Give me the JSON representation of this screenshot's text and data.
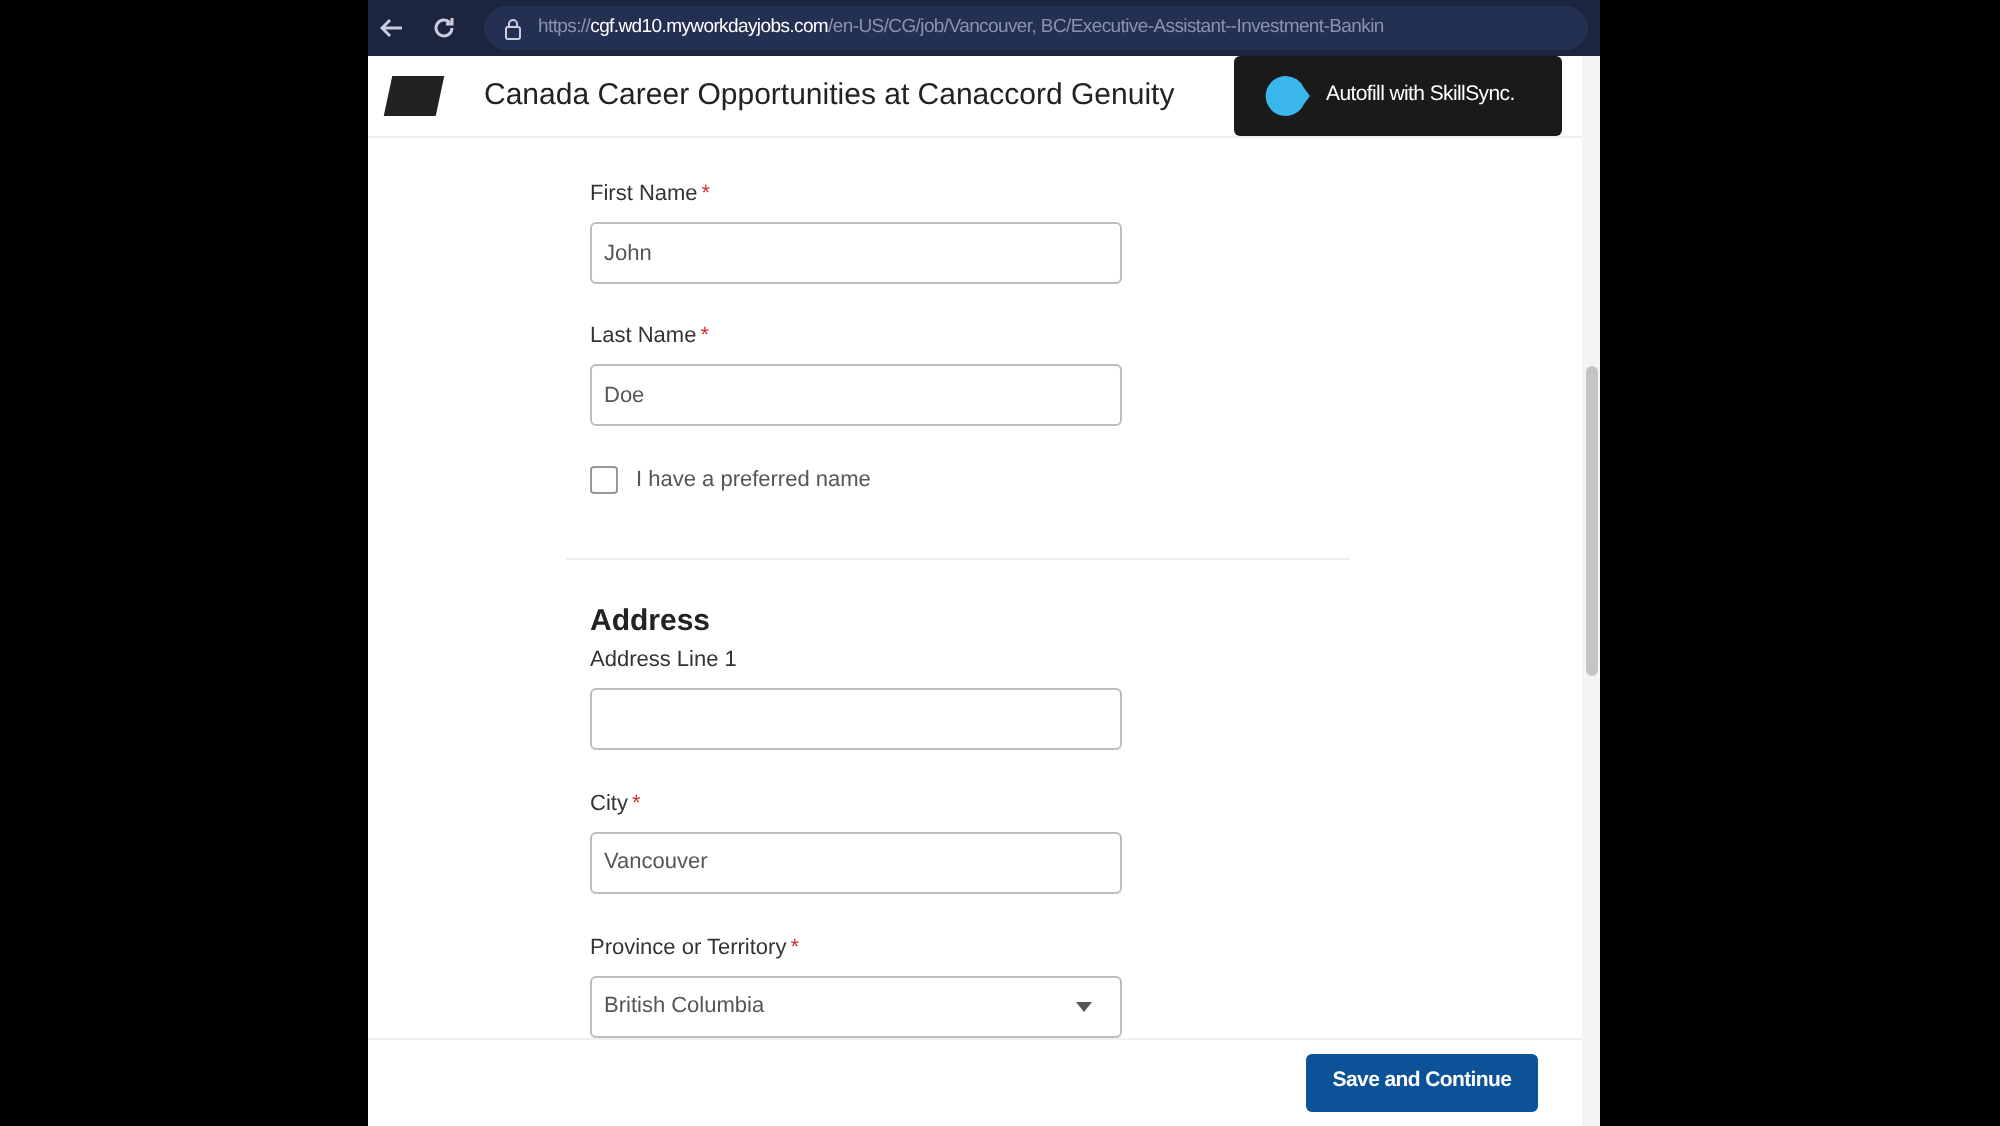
{
  "browser": {
    "url_scheme": "https://",
    "url_domain": "cgf.wd10.myworkdayjobs.com",
    "url_path": "/en-US/CG/job/Vancouver, BC/Executive-Assistant--Investment-Bankin"
  },
  "header": {
    "title": "Canada Career Opportunities at Canaccord Genuity",
    "autofill_button": "Autofill with SkillSync."
  },
  "legal_name": {
    "fields": [
      {
        "label": "First Name",
        "required_marker": "*",
        "value": "John"
      },
      {
        "label": "Last Name",
        "required_marker": "*",
        "value": "Doe"
      }
    ],
    "preferred_name": {
      "label": "I have a preferred name",
      "checked": false
    }
  },
  "address": {
    "heading": "Address",
    "fields": [
      {
        "kind": "text",
        "label": "Address Line 1"
      },
      {
        "kind": "text",
        "label": "City",
        "required_marker": "*",
        "value": "Vancouver"
      },
      {
        "kind": "select",
        "label": "Province or Territory",
        "required_marker": "*",
        "value": "British Columbia"
      }
    ]
  },
  "footer": {
    "button": "Save and Continue"
  }
}
